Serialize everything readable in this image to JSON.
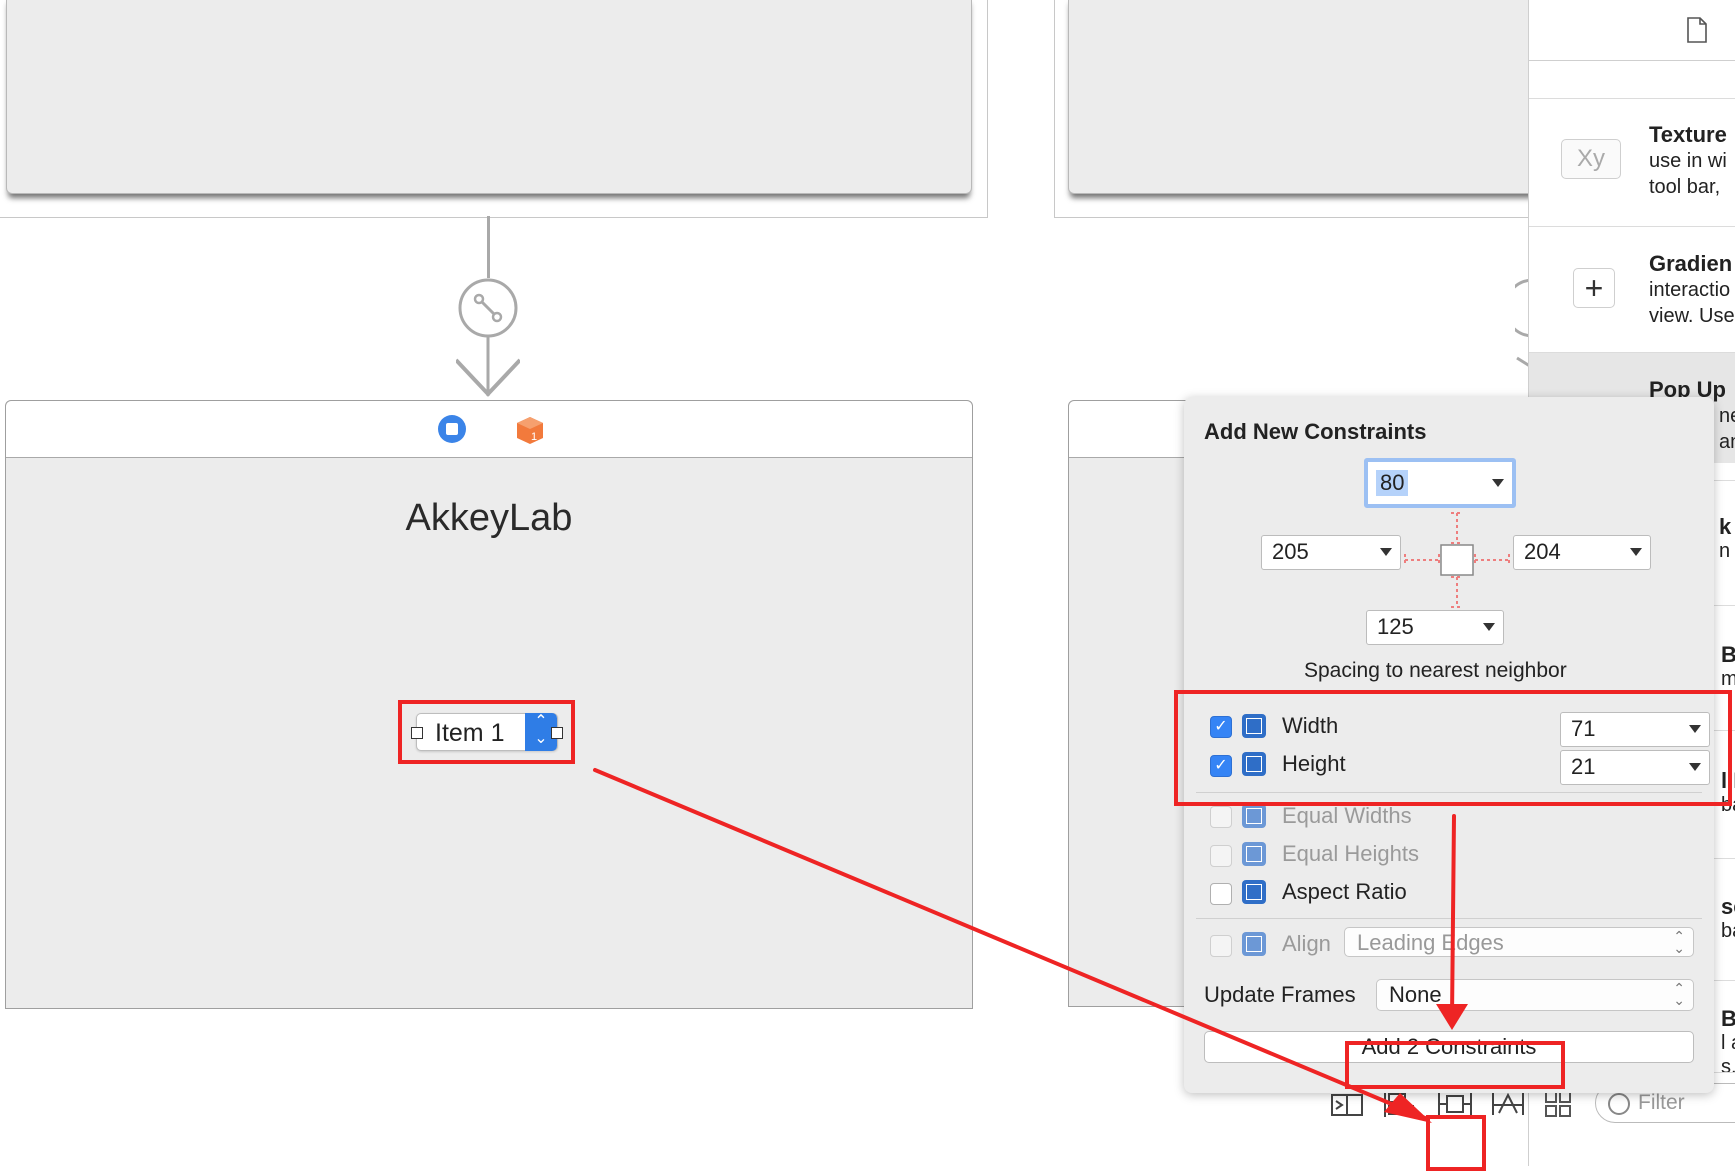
{
  "scene": {
    "title": "AkkeyLab",
    "popup_item": "Item 1"
  },
  "library": {
    "items": [
      {
        "title": "Texture",
        "desc": "use in wi\ntool bar,",
        "thumb": "Xy"
      },
      {
        "title": "Gradien",
        "desc": "interactio\nview. Use",
        "thumb": "+"
      },
      {
        "title": "Pop Up",
        "desc": "ne\nan"
      }
    ],
    "edge_fragments": [
      "k B",
      "n d",
      "B",
      "m",
      "l F",
      "ba",
      "se",
      "ba",
      "Bu",
      "l a",
      "s."
    ],
    "filter_placeholder": "Filter"
  },
  "constraints": {
    "title": "Add New Constraints",
    "top": "80",
    "left": "205",
    "right": "204",
    "bottom": "125",
    "spacing_label": "Spacing to nearest neighbor",
    "width_label": "Width",
    "width_value": "71",
    "height_label": "Height",
    "height_value": "21",
    "equal_widths": "Equal Widths",
    "equal_heights": "Equal Heights",
    "aspect_ratio": "Aspect Ratio",
    "align_label": "Align",
    "align_value": "Leading Edges",
    "update_frames_label": "Update Frames",
    "update_frames_value": "None",
    "add_button": "Add 2 Constraints"
  },
  "colors": {
    "annotation_red": "#ee2424",
    "checkbox_blue": "#3584f5",
    "canvas_gray": "#ececec"
  }
}
